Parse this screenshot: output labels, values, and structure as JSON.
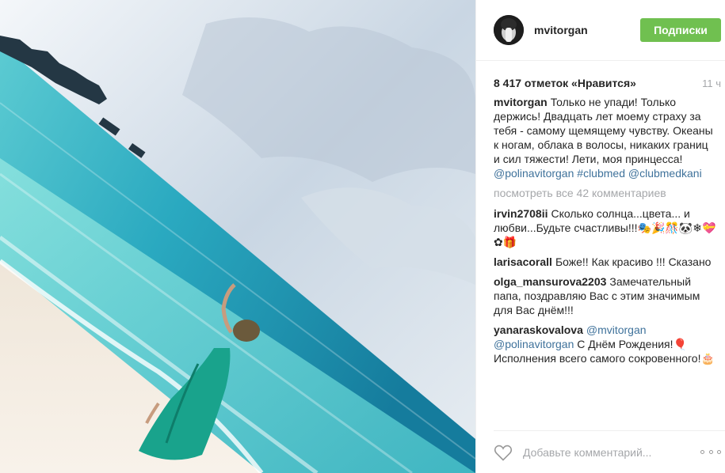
{
  "post": {
    "author": "mvitorgan",
    "follow_label": "Подписки",
    "likes_label": "8 417 отметок «Нравится»",
    "time_label": "11 ч",
    "caption": {
      "user": "mvitorgan",
      "text": "Только не упади! Только держись! Двадцать лет моему страху за тебя - самому щемящему чувству. Океаны к ногам, облака в волосы, никаких границ и сил тяжести! Лети, моя принцесса!",
      "mention_1": "@polinavitorgan",
      "hashtag": "#clubmed",
      "mention_2": "@clubmedkani"
    },
    "view_all_label": "посмотреть все 42 комментариев",
    "comments": [
      {
        "user": "irvin2708ii",
        "text": "Сколько солнца...цвета... и любви...Будьте счастливы!!!🎭🎉🎊🐼❄💝✿🎁"
      },
      {
        "user": "larisacorall",
        "text": "Боже!! Как красиво !!! Сказано"
      },
      {
        "user": "olga_mansurova2203",
        "text": "Замечательный папа, поздравляю Вас с этим значимым для Вас днём!!!"
      },
      {
        "user": "yanaraskovalova",
        "mention_1": "@mvitorgan",
        "mention_2": "@polinavitorgan",
        "text": "С Днём Рождения!🎈 Исполнения всего самого сокровенного!🎂"
      }
    ],
    "add_comment_placeholder": "Добавьте комментарий...",
    "icons": {
      "like": "heart-icon",
      "more": "more-options-icon"
    },
    "colors": {
      "follow_button": "#70c050",
      "link": "#3f729b",
      "muted": "#a5a7aa"
    }
  }
}
